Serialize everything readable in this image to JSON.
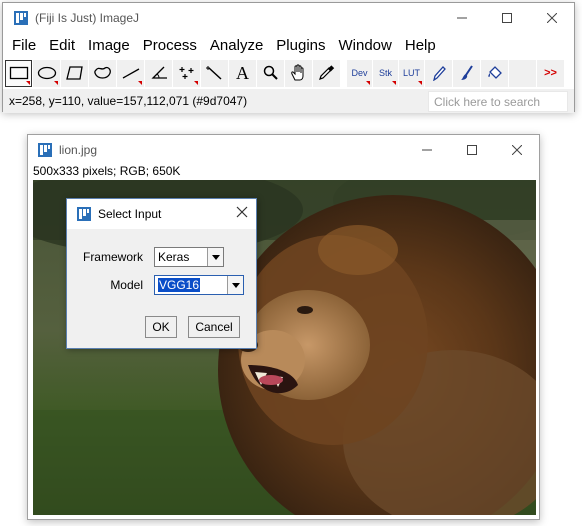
{
  "imagej": {
    "title": "(Fiji Is Just) ImageJ",
    "menus": [
      "File",
      "Edit",
      "Image",
      "Process",
      "Analyze",
      "Plugins",
      "Window",
      "Help"
    ],
    "tools": [
      {
        "name": "rectangle-tool-icon",
        "active": true
      },
      {
        "name": "oval-tool-icon"
      },
      {
        "name": "polygon-tool-icon"
      },
      {
        "name": "freehand-tool-icon"
      },
      {
        "name": "line-tool-icon"
      },
      {
        "name": "angle-tool-icon"
      },
      {
        "name": "multipoint-tool-icon"
      },
      {
        "name": "wand-tool-icon"
      },
      {
        "name": "text-tool-icon",
        "glyph": "A"
      },
      {
        "name": "magnifier-tool-icon"
      },
      {
        "name": "hand-tool-icon"
      },
      {
        "name": "color-picker-tool-icon"
      },
      {
        "name": "dev-menu-icon",
        "glyph": "Dev"
      },
      {
        "name": "stacks-menu-icon",
        "glyph": "Stk"
      },
      {
        "name": "lut-menu-icon",
        "glyph": "LUT"
      },
      {
        "name": "pencil-tool-icon"
      },
      {
        "name": "brush-tool-icon"
      },
      {
        "name": "flood-fill-tool-icon"
      },
      {
        "name": "more-tools-icon",
        "glyph": ">>"
      }
    ],
    "status": "x=258, y=110, value=157,112,071 (#9d7047)",
    "search_placeholder": "Click here to search"
  },
  "image_window": {
    "title": "lion.jpg",
    "info": "500x333 pixels; RGB; 650K"
  },
  "dialog": {
    "title": "Select Input",
    "framework_label": "Framework",
    "framework_value": "Keras",
    "model_label": "Model",
    "model_value": "VGG16",
    "ok_label": "OK",
    "cancel_label": "Cancel"
  },
  "colors": {
    "accent": "#0a4ec8",
    "red_indicator": "#d40000",
    "imagej_icon": "#2a6fb8"
  }
}
